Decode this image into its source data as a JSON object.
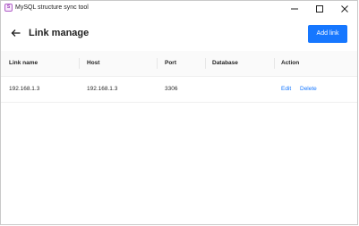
{
  "window": {
    "title": "MySQL structure sync tool"
  },
  "header": {
    "title": "Link manage",
    "add_button_label": "Add link"
  },
  "table": {
    "columns": [
      "Link name",
      "Host",
      "Port",
      "Database",
      "Action"
    ],
    "rows": [
      {
        "link_name": "192.168.1.3",
        "host": "192.168.1.3",
        "port": "3306",
        "database": "",
        "actions": [
          "Edit",
          "Delete"
        ]
      }
    ]
  },
  "icons": {
    "app": "app-logo-icon",
    "back": "arrow-left-icon",
    "minimize": "minimize-icon",
    "maximize": "maximize-icon",
    "close": "close-icon"
  },
  "colors": {
    "accent": "#1677ff",
    "header_bg": "#fafafa"
  }
}
